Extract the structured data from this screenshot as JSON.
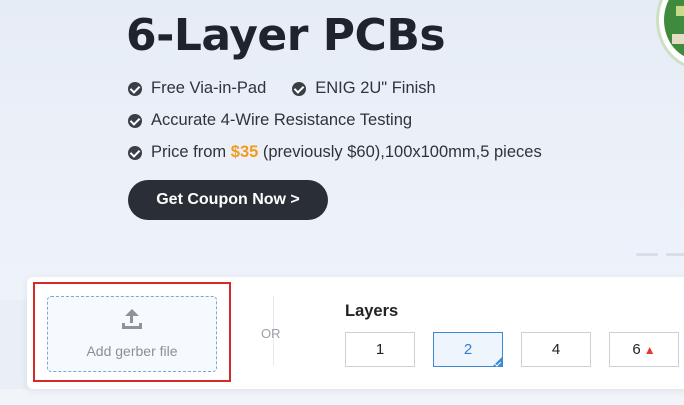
{
  "hero": {
    "title": "6-Layer PCBs",
    "features_row1": [
      "Free Via-in-Pad",
      "ENIG 2U\" Finish"
    ],
    "feature_row2": "Accurate 4-Wire Resistance Testing",
    "price_prefix": "Price from ",
    "price_value": "$35",
    "price_suffix": " (previously $60),100x100mm,5 pieces",
    "cta_label": "Get Coupon Now >"
  },
  "upload": {
    "label": "Add gerber file"
  },
  "or_label": "OR",
  "layers": {
    "title": "Layers",
    "options": [
      "1",
      "2",
      "4",
      "6"
    ],
    "selected": "2"
  },
  "colors": {
    "accent": "#3b8ad8",
    "price": "#f39a1a",
    "highlight": "#d42a2a",
    "cta_bg": "#2a2f37"
  }
}
